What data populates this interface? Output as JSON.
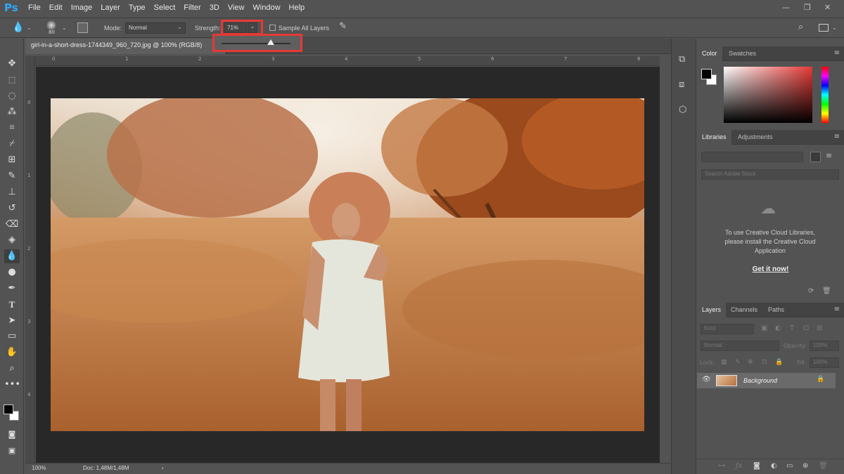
{
  "app": {
    "logo": "Ps"
  },
  "menu": [
    "File",
    "Edit",
    "Image",
    "Layer",
    "Type",
    "Select",
    "Filter",
    "3D",
    "View",
    "Window",
    "Help"
  ],
  "window_controls": {
    "minimize": "—",
    "restore": "❐",
    "close": "✕"
  },
  "options": {
    "brush_size": "80",
    "mode_label": "Mode:",
    "mode_value": "Normal",
    "strength_label": "Strength:",
    "strength_value": "71%",
    "strength_fraction": 0.71,
    "sample_all_layers": "Sample All Layers"
  },
  "document": {
    "tab_title": "girl-in-a-short-dress-1744349_960_720.jpg @ 100% (RGB/8)",
    "hruler_ticks": [
      "0",
      "1",
      "2",
      "3",
      "4",
      "5",
      "6",
      "7",
      "8"
    ],
    "vruler_ticks": [
      "0",
      "1",
      "2",
      "3",
      "4"
    ]
  },
  "status": {
    "zoom": "100%",
    "doc": "Doc: 1,48M/1,48M",
    "arrow": "›"
  },
  "color_panel": {
    "tabs": [
      "Color",
      "Swatches"
    ],
    "accent": "#e53935"
  },
  "libraries_panel": {
    "tabs": [
      "Libraries",
      "Adjustments"
    ],
    "search_placeholder": "Search Adobe Stock",
    "message": "To use Creative Cloud Libraries, please install the Creative Cloud Application",
    "link": "Get it now!"
  },
  "layers_panel": {
    "tabs": [
      "Layers",
      "Channels",
      "Paths"
    ],
    "kind_label": "Kind",
    "blend_mode": "Normal",
    "opacity_label": "Opacity:",
    "opacity_value": "100%",
    "lock_label": "Lock:",
    "fill_label": "Fill:",
    "fill_value": "100%",
    "layer_name": "Background"
  }
}
